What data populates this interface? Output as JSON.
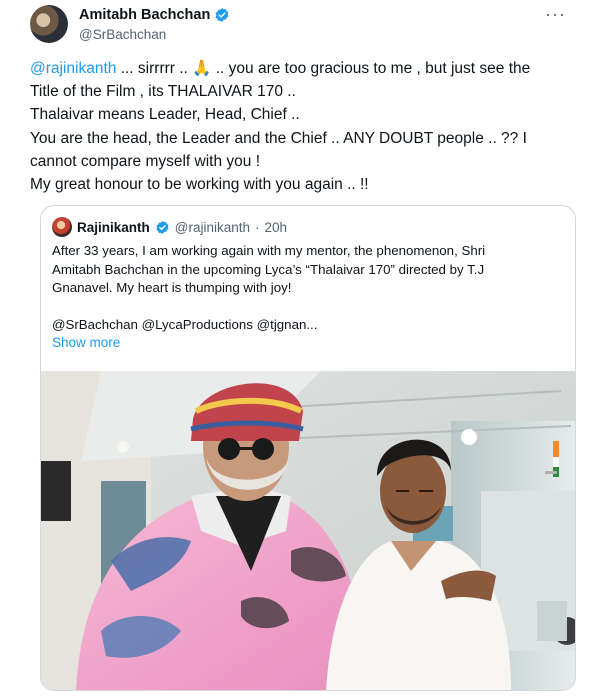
{
  "author": {
    "display_name": "Amitabh Bachchan",
    "handle": "@SrBachchan"
  },
  "tweet": {
    "lines": [
      {
        "mention": "@rajinikanth",
        "text": " ... sirrrrr .. 🙏 .. you are too gracious to me , but just see the"
      },
      {
        "text": "Title of the Film , its THALAIVAR 170 .."
      },
      {
        "text": "Thalaivar means Leader, Head, Chief .."
      },
      {
        "text": "You are the head, the Leader and the Chief .. ANY DOUBT people .. ?? I"
      },
      {
        "text": "cannot compare myself with you  !"
      },
      {
        "text": "My great honour to be working with you again .. !!"
      }
    ]
  },
  "quoted": {
    "display_name": "Rajinikanth",
    "handle": "@rajinikanth",
    "time": "20h",
    "lines": [
      "After 33 years, I am working again with my mentor, the phenomenon, Shri",
      "Amitabh Bachchan in the upcoming Lyca’s “Thalaivar 170” directed by T.J",
      "Gnanavel. My heart is thumping with joy!",
      "",
      "@SrBachchan @LycaProductions @tjgnan..."
    ],
    "show_more": "Show more"
  },
  "colors": {
    "link": "#1d9bf0",
    "text": "#0f1419",
    "muted": "#536471",
    "border": "#cfd9de"
  }
}
